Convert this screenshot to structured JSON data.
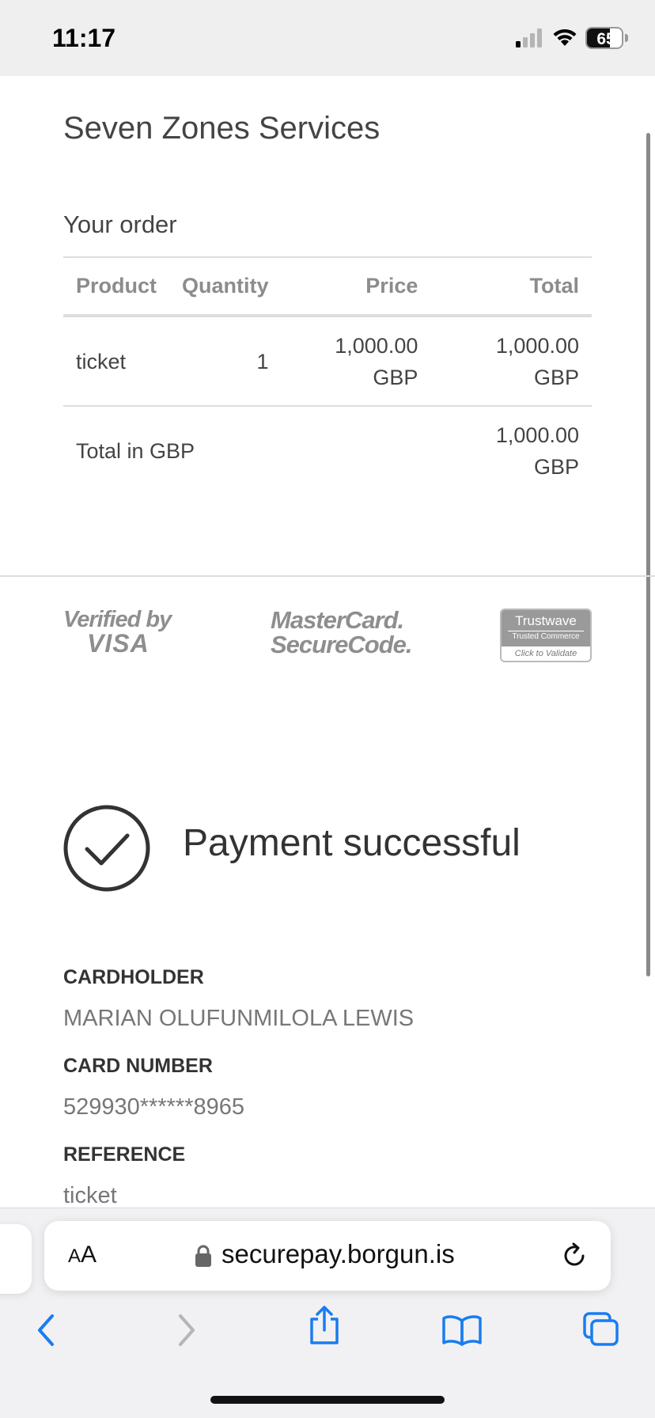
{
  "status_bar": {
    "time": "11:17",
    "battery_percent": "65",
    "battery_level": 0.65,
    "icons": [
      "cellular-signal-icon",
      "wifi-icon",
      "battery-icon"
    ]
  },
  "merchant": {
    "name": "Seven Zones Services"
  },
  "order": {
    "title": "Your order",
    "columns": {
      "product": "Product",
      "quantity": "Quantity",
      "price": "Price",
      "total": "Total"
    },
    "items": [
      {
        "product": "ticket",
        "quantity": "1",
        "price_amount": "1,000.00",
        "price_currency": "GBP",
        "total_amount": "1,000.00",
        "total_currency": "GBP"
      }
    ],
    "grand_total": {
      "label": "Total in GBP",
      "amount": "1,000.00",
      "currency": "GBP"
    }
  },
  "security_logos": {
    "visa": {
      "line1": "Verified by",
      "line2": "VISA"
    },
    "mastercard": {
      "line1": "MasterCard.",
      "line2": "SecureCode."
    },
    "trustwave": {
      "name": "Trustwave",
      "subtitle": "Trusted Commerce",
      "action": "Click to Validate"
    }
  },
  "payment": {
    "status": "Payment successful",
    "fields": [
      {
        "label": "CARDHOLDER",
        "value": "MARIAN OLUFUNMILOLA LEWIS"
      },
      {
        "label": "CARD NUMBER",
        "value": "529930******8965"
      },
      {
        "label": "REFERENCE",
        "value": "ticket"
      }
    ]
  },
  "browser": {
    "text_size_label_small": "A",
    "text_size_label_large": "A",
    "url": "securepay.borgun.is",
    "toolbar_icons": [
      "back-icon",
      "forward-icon",
      "share-icon",
      "bookmarks-icon",
      "tabs-icon"
    ],
    "accent_color": "#1a7cf0"
  },
  "colors": {
    "heading": "#444444",
    "muted": "#8c8c8c",
    "divider": "#dddddd"
  }
}
